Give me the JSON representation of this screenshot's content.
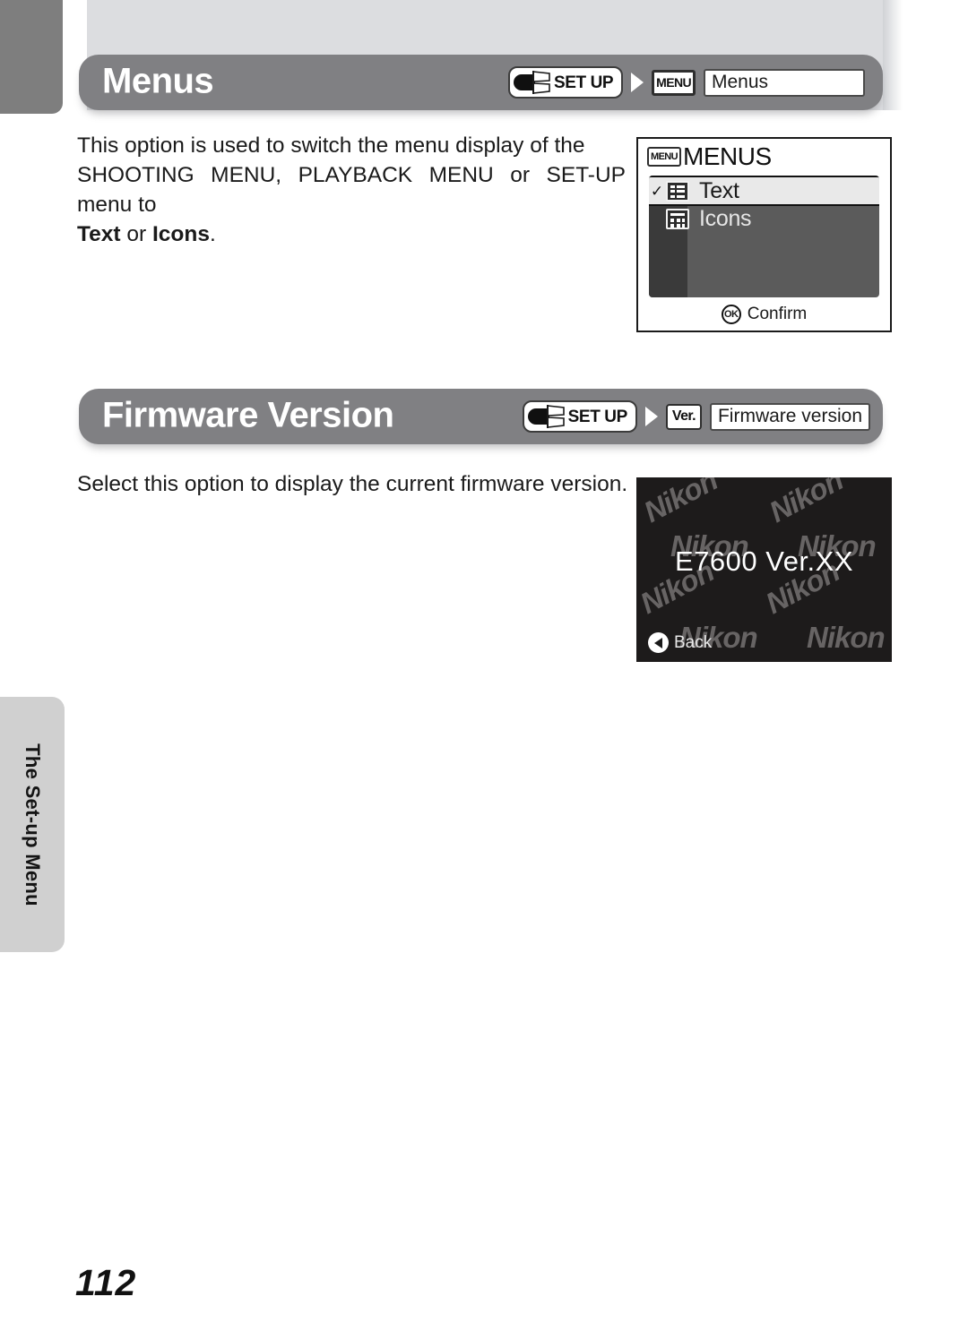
{
  "page": {
    "number": "112",
    "side_tab_label": "The Set-up Menu"
  },
  "sections": [
    {
      "id": "menus",
      "title": "Menus",
      "crumb": {
        "dial_label": "SET UP",
        "dial_icon": "mode-dial-icon",
        "arrow_icon": "arrow-right-icon",
        "badge_label": "MENU",
        "field_value": "Menus"
      },
      "body": {
        "line1": "This option is used to switch the menu display of the",
        "line2": "SHOOTING MENU, PLAYBACK MENU or SET-UP menu to",
        "line3_pre": "",
        "line3_bold1": "Text",
        "line3_mid": " or ",
        "line3_bold2": "Icons",
        "line3_post": "."
      },
      "screen": {
        "header_badge": "MENU",
        "header_title": "MENUS",
        "items": [
          {
            "label": "Text",
            "icon": "list-view-icon",
            "selected": true,
            "checked": true,
            "check_glyph": "✓"
          },
          {
            "label": "Icons",
            "icon": "grid-view-icon",
            "selected": false,
            "checked": false,
            "check_glyph": ""
          }
        ],
        "footer_glyph": "OK",
        "footer_label": "Confirm"
      }
    },
    {
      "id": "firmware",
      "title": "Firmware Version",
      "crumb": {
        "dial_label": "SET UP",
        "dial_icon": "mode-dial-icon",
        "arrow_icon": "arrow-right-icon",
        "badge_label": "Ver.",
        "field_value": "Firmware version"
      },
      "body": {
        "line1": "Select this option to display the current firmware version."
      },
      "screen": {
        "version_text": "E7600 Ver.XX",
        "back_label": "Back",
        "back_icon": "circle-left-arrow-icon",
        "watermark_text": "Nikon"
      }
    }
  ],
  "colors": {
    "header_bar": "#808083",
    "top_band": "#dcdde0",
    "corner_tab": "#7e7e7e",
    "side_tab": "#d0d0d0",
    "lcd_dark": "#1d1b1b",
    "panel_gray": "#5b5b5b",
    "rail_gray": "#3a3a3a"
  }
}
